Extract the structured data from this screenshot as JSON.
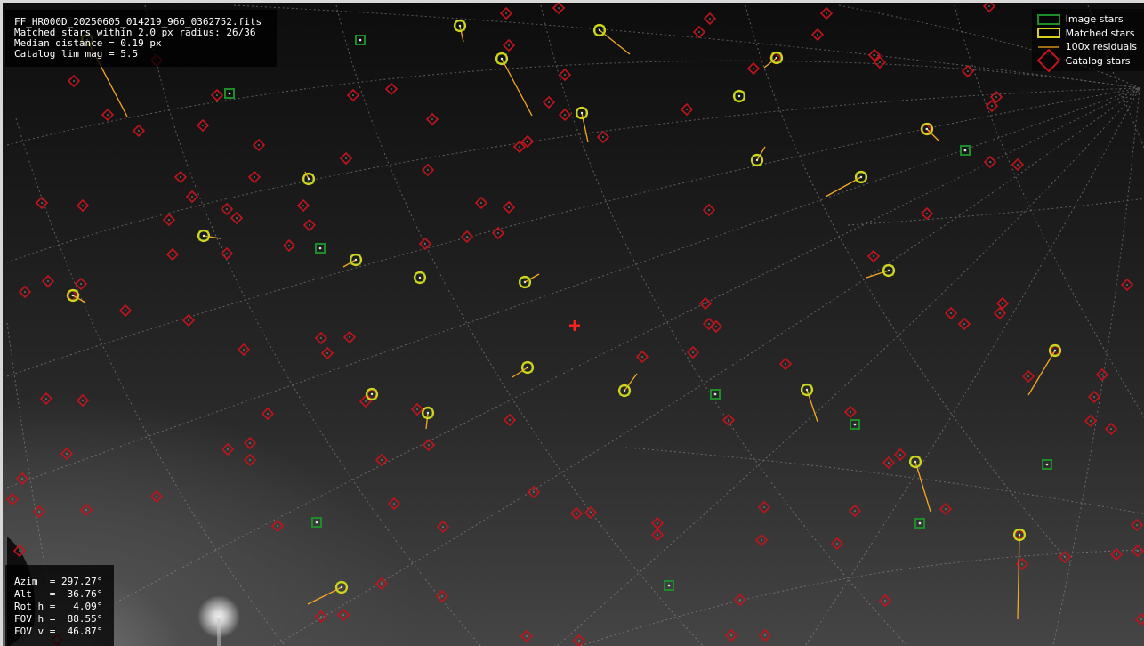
{
  "info_top": {
    "filename": "FF_HR000D_20250605_014219_966_0362752.fits",
    "matched": "Matched stars within 2.0 px radius: 26/36",
    "median": "Median distance = 0.19 px",
    "limmag": "Catalog lim mag = 5.5"
  },
  "info_bottom": {
    "azim": "Azim  = 297.27°",
    "alt": "Alt   =  36.76°",
    "roth": "Rot h =   4.09°",
    "fovh": "FOV h =  88.55°",
    "fovv": "FOV v =  46.87°"
  },
  "legend": {
    "image_stars": "Image stars",
    "matched_stars": "Matched stars",
    "residuals": "100x residuals",
    "catalog_stars": "Catalog stars"
  },
  "colors": {
    "catalog": "#c0141c",
    "image": "#1e8c28",
    "matched": "#d6d11e",
    "residual": "#f5a623",
    "center": "#ff2020"
  },
  "markers": {
    "image_stars": [
      [
        402,
        42
      ],
      [
        255,
        102
      ],
      [
        357,
        276
      ],
      [
        1082,
        166
      ],
      [
        801,
        440
      ],
      [
        958,
        474
      ],
      [
        1174,
        519
      ],
      [
        353,
        584
      ],
      [
        1031,
        585
      ],
      [
        749,
        655
      ]
    ],
    "matched_stars": [
      {
        "p": [
          514,
          26
        ],
        "r": [
          518,
          44
        ]
      },
      {
        "p": [
          671,
          31
        ],
        "r": [
          705,
          58
        ]
      },
      {
        "p": [
          870,
          62
        ],
        "r": [
          856,
          73
        ]
      },
      {
        "p": [
          561,
          63
        ],
        "r": [
          595,
          127
        ]
      },
      {
        "p": [
          828,
          105
        ],
        "r": [
          828,
          105
        ]
      },
      {
        "p": [
          651,
          124
        ],
        "r": [
          658,
          157
        ]
      },
      {
        "p": [
          1039,
          142
        ],
        "r": [
          1052,
          155
        ]
      },
      {
        "p": [
          848,
          177
        ],
        "r": [
          857,
          162
        ]
      },
      {
        "p": [
          965,
          196
        ],
        "r": [
          925,
          218
        ]
      },
      {
        "p": [
          344,
          198
        ],
        "r": [
          340,
          190
        ]
      },
      {
        "p": [
          226,
          262
        ],
        "r": [
          245,
          265
        ]
      },
      {
        "p": [
          397,
          289
        ],
        "r": [
          383,
          297
        ]
      },
      {
        "p": [
          996,
          301
        ],
        "r": [
          971,
          309
        ]
      },
      {
        "p": [
          469,
          309
        ],
        "r": [
          469,
          309
        ]
      },
      {
        "p": [
          587,
          314
        ],
        "r": [
          603,
          305
        ]
      },
      {
        "p": [
          79,
          329
        ],
        "r": [
          93,
          337
        ]
      },
      {
        "p": [
          1183,
          391
        ],
        "r": [
          1153,
          441
        ]
      },
      {
        "p": [
          590,
          410
        ],
        "r": [
          573,
          421
        ]
      },
      {
        "p": [
          415,
          440
        ],
        "r": [
          415,
          440
        ]
      },
      {
        "p": [
          699,
          436
        ],
        "r": [
          713,
          417
        ]
      },
      {
        "p": [
          904,
          435
        ],
        "r": [
          916,
          471
        ]
      },
      {
        "p": [
          478,
          461
        ],
        "r": [
          476,
          479
        ]
      },
      {
        "p": [
          1026,
          516
        ],
        "r": [
          1043,
          572
        ]
      },
      {
        "p": [
          1143,
          598
        ],
        "r": [
          1141,
          693
        ]
      },
      {
        "p": [
          381,
          657
        ],
        "r": [
          343,
          676
        ]
      },
      {
        "p": [
          95,
          42
        ],
        "r": [
          140,
          128
        ]
      }
    ],
    "catalog_stars": [
      [
        566,
        12
      ],
      [
        625,
        6
      ],
      [
        795,
        18
      ],
      [
        783,
        33
      ],
      [
        926,
        12
      ],
      [
        916,
        36
      ],
      [
        1109,
        4
      ],
      [
        569,
        48
      ],
      [
        632,
        81
      ],
      [
        844,
        74
      ],
      [
        869,
        62
      ],
      [
        980,
        59
      ],
      [
        986,
        67
      ],
      [
        1085,
        77
      ],
      [
        1117,
        106
      ],
      [
        1112,
        116
      ],
      [
        614,
        112
      ],
      [
        632,
        126
      ],
      [
        675,
        151
      ],
      [
        769,
        120
      ],
      [
        590,
        156
      ],
      [
        581,
        162
      ],
      [
        1038,
        142
      ],
      [
        1110,
        179
      ],
      [
        1141,
        182
      ],
      [
        394,
        104
      ],
      [
        437,
        97
      ],
      [
        483,
        131
      ],
      [
        478,
        188
      ],
      [
        386,
        175
      ],
      [
        338,
        228
      ],
      [
        288,
        160
      ],
      [
        283,
        196
      ],
      [
        225,
        138
      ],
      [
        200,
        196
      ],
      [
        153,
        144
      ],
      [
        118,
        126
      ],
      [
        80,
        88
      ],
      [
        173,
        65
      ],
      [
        241,
        104
      ],
      [
        44,
        225
      ],
      [
        90,
        228
      ],
      [
        213,
        218
      ],
      [
        252,
        232
      ],
      [
        263,
        242
      ],
      [
        187,
        244
      ],
      [
        191,
        283
      ],
      [
        252,
        282
      ],
      [
        322,
        273
      ],
      [
        345,
        250
      ],
      [
        522,
        263
      ],
      [
        557,
        259
      ],
      [
        569,
        230
      ],
      [
        538,
        225
      ],
      [
        475,
        271
      ],
      [
        794,
        233
      ],
      [
        1039,
        237
      ],
      [
        979,
        285
      ],
      [
        51,
        313
      ],
      [
        88,
        316
      ],
      [
        25,
        325
      ],
      [
        78,
        329
      ],
      [
        138,
        346
      ],
      [
        209,
        357
      ],
      [
        358,
        377
      ],
      [
        390,
        376
      ],
      [
        365,
        394
      ],
      [
        271,
        390
      ],
      [
        790,
        338
      ],
      [
        794,
        361
      ],
      [
        802,
        364
      ],
      [
        776,
        393
      ],
      [
        719,
        398
      ],
      [
        880,
        406
      ],
      [
        1124,
        338
      ],
      [
        1121,
        349
      ],
      [
        1066,
        349
      ],
      [
        1081,
        361
      ],
      [
        1264,
        317
      ],
      [
        1183,
        391
      ],
      [
        1153,
        420
      ],
      [
        1236,
        418
      ],
      [
        1227,
        443
      ],
      [
        1223,
        470
      ],
      [
        1246,
        479
      ],
      [
        49,
        445
      ],
      [
        90,
        447
      ],
      [
        298,
        462
      ],
      [
        415,
        440
      ],
      [
        408,
        448
      ],
      [
        466,
        457
      ],
      [
        479,
        497
      ],
      [
        570,
        469
      ],
      [
        816,
        469
      ],
      [
        953,
        460
      ],
      [
        253,
        502
      ],
      [
        278,
        495
      ],
      [
        278,
        514
      ],
      [
        72,
        507
      ],
      [
        426,
        514
      ],
      [
        22,
        535
      ],
      [
        11,
        558
      ],
      [
        41,
        572
      ],
      [
        94,
        570
      ],
      [
        173,
        555
      ],
      [
        309,
        588
      ],
      [
        440,
        563
      ],
      [
        495,
        589
      ],
      [
        597,
        550
      ],
      [
        645,
        574
      ],
      [
        661,
        573
      ],
      [
        736,
        585
      ],
      [
        736,
        598
      ],
      [
        856,
        567
      ],
      [
        853,
        604
      ],
      [
        938,
        608
      ],
      [
        958,
        571
      ],
      [
        1009,
        508
      ],
      [
        996,
        517
      ],
      [
        1060,
        569
      ],
      [
        1143,
        598
      ],
      [
        1146,
        631
      ],
      [
        1194,
        623
      ],
      [
        1252,
        620
      ],
      [
        1275,
        587
      ],
      [
        1276,
        616
      ],
      [
        1280,
        693
      ],
      [
        19,
        616
      ],
      [
        358,
        690
      ],
      [
        383,
        688
      ],
      [
        426,
        653
      ],
      [
        494,
        667
      ],
      [
        829,
        671
      ],
      [
        992,
        672
      ],
      [
        589,
        712
      ],
      [
        648,
        717
      ],
      [
        819,
        711
      ],
      [
        857,
        711
      ],
      [
        61,
        716
      ]
    ],
    "center_cross": [
      643,
      363
    ]
  }
}
